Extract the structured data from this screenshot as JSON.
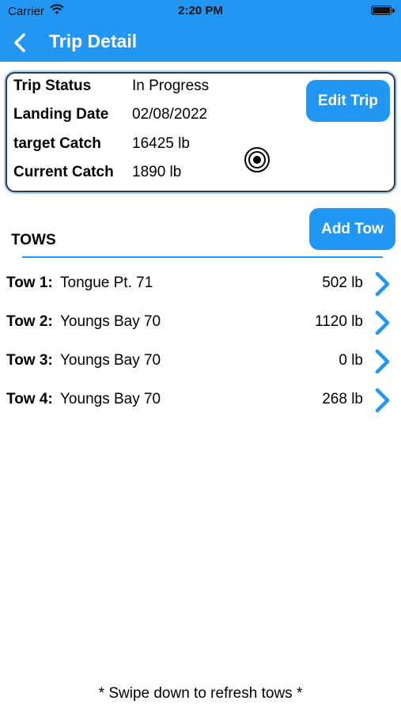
{
  "status_bar": {
    "carrier": "Carrier",
    "time": "2:20 PM"
  },
  "nav": {
    "title": "Trip Detail"
  },
  "summary": {
    "rows": [
      {
        "label": "Trip Status",
        "value": "In Progress"
      },
      {
        "label": "Landing Date",
        "value": "02/08/2022"
      },
      {
        "label": "target Catch",
        "value": "16425 lb"
      },
      {
        "label": "Current Catch",
        "value": "1890 lb"
      }
    ],
    "edit_button": "Edit Trip"
  },
  "tows": {
    "header": "TOWS",
    "add_button": "Add Tow",
    "items": [
      {
        "label": "Tow 1:",
        "location": "Tongue Pt. 71",
        "weight": "502 lb"
      },
      {
        "label": "Tow 2:",
        "location": "Youngs Bay 70",
        "weight": "1120 lb"
      },
      {
        "label": "Tow 3:",
        "location": "Youngs Bay 70",
        "weight": "0 lb"
      },
      {
        "label": "Tow 4:",
        "location": "Youngs Bay 70",
        "weight": "268 lb"
      }
    ]
  },
  "footer": {
    "hint": "* Swipe down to refresh tows *"
  },
  "colors": {
    "accent": "#2196f3",
    "text": "#000000",
    "background": "#ffffff"
  },
  "icons": [
    "wifi-icon",
    "battery-icon",
    "back-chevron-icon",
    "target-icon",
    "chevron-right-icon"
  ]
}
